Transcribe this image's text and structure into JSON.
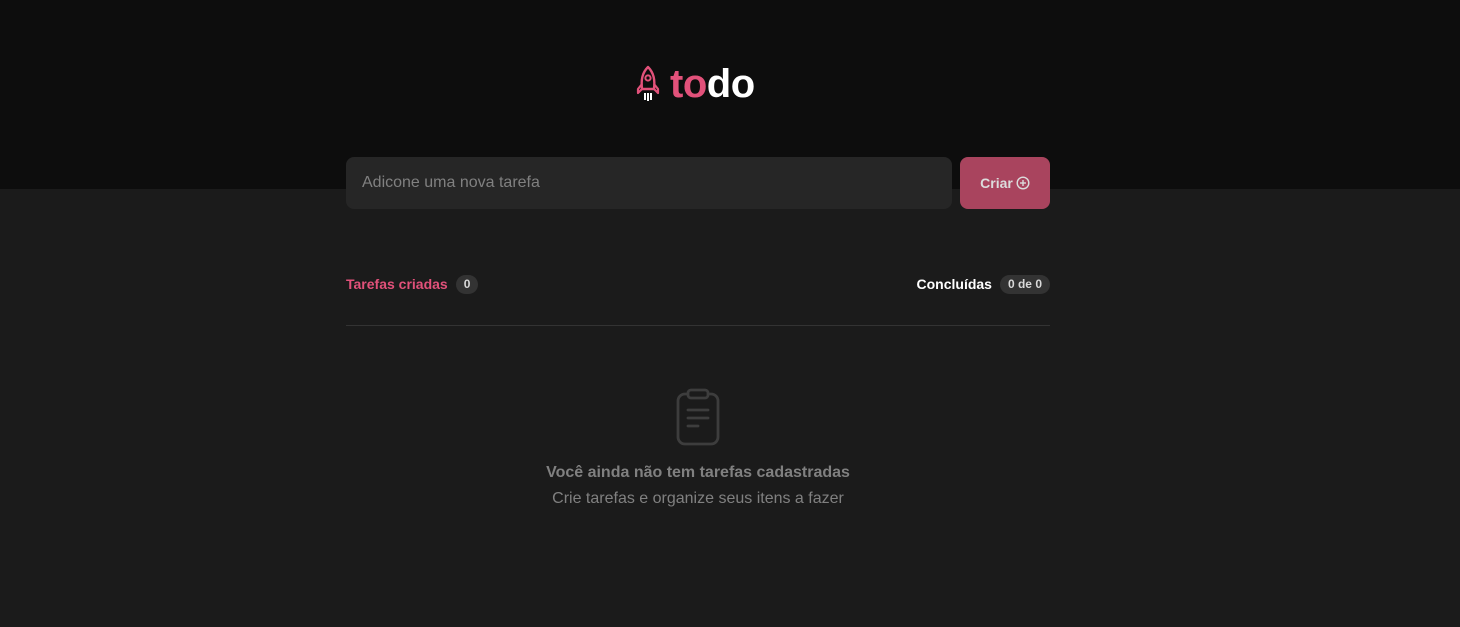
{
  "header": {
    "logo_part1": "to",
    "logo_part2": "do",
    "logo_icon": "rocket-icon"
  },
  "new_task": {
    "placeholder": "Adicone uma nova tarefa",
    "value": "",
    "create_label": "Criar",
    "create_icon": "plus-circle-icon"
  },
  "counters": {
    "created_label": "Tarefas criadas",
    "created_count": "0",
    "done_label": "Concluídas",
    "done_count": "0 de 0"
  },
  "empty_state": {
    "icon": "clipboard-icon",
    "title": "Você ainda não tem tarefas cadastradas",
    "subtitle": "Crie tarefas e organize seus itens a fazer"
  },
  "colors": {
    "accent": "#e2517a",
    "button_bg": "#a9445e",
    "header_bg": "#0d0d0d",
    "body_bg": "#1b1b1b",
    "input_bg": "#262626",
    "badge_bg": "#333333"
  }
}
